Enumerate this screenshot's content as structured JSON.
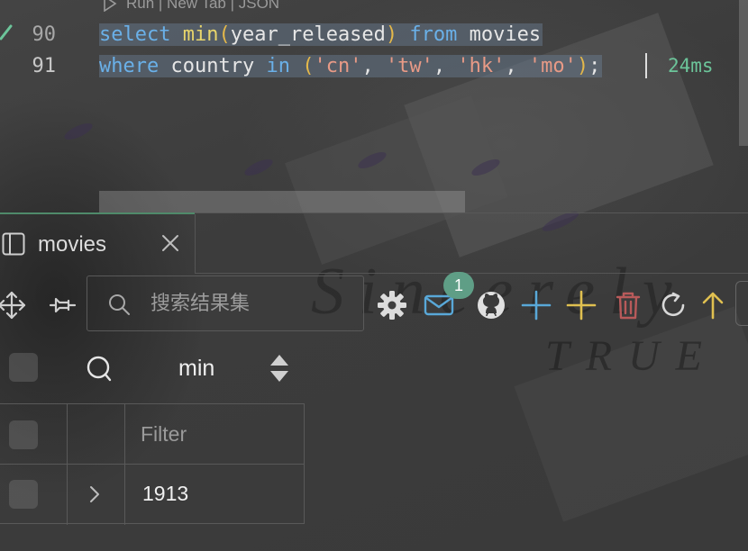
{
  "editor": {
    "codelens": "Run | New Tab | JSON",
    "lines": [
      {
        "number": "90",
        "tokens": [
          "select",
          " ",
          "min",
          "(",
          "year_released",
          ")",
          " ",
          "from",
          " movies"
        ]
      },
      {
        "number": "91",
        "tokens": [
          "where",
          " country ",
          "in",
          " ",
          "(",
          "'cn'",
          ", ",
          "'tw'",
          ", ",
          "'hk'",
          ", ",
          "'mo'",
          ")",
          ";"
        ]
      }
    ],
    "execution_time": "24ms"
  },
  "results": {
    "tab_label": "movies",
    "search_placeholder": "搜索结果集",
    "notification_count": "1",
    "column_header": "min",
    "filter_placeholder": "Filter",
    "rows": [
      {
        "min": "1913"
      }
    ]
  },
  "background": {
    "watermark_top": "Sincerely",
    "watermark_bottom": "TRUE"
  },
  "colors": {
    "keyword": "#6ab0e8",
    "function": "#e8d56b",
    "string": "#e89a86",
    "timing": "#6cc59a",
    "accent_green": "#4f8a6a",
    "badge": "#5f9e86",
    "add_blue": "#59a8d8",
    "add_yellow": "#e0c050",
    "delete_red": "#b85a5a"
  }
}
